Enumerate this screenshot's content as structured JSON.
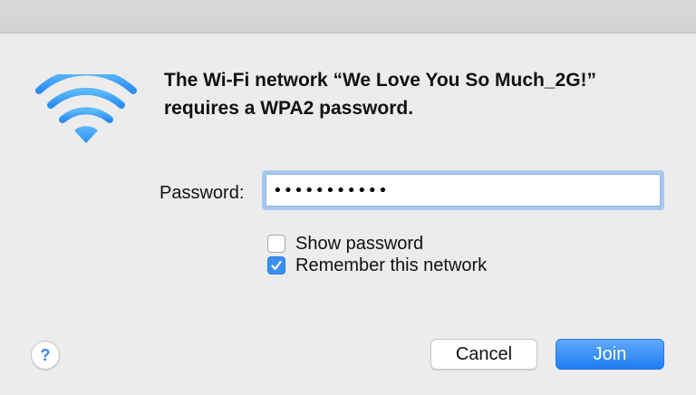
{
  "dialog": {
    "message_line1": "The Wi-Fi network “We Love You So Much_2G!”",
    "message_line2": "requires a WPA2 password.",
    "icon": "wifi-icon",
    "accent_color": "#3b8ff3"
  },
  "password": {
    "label": "Password:",
    "value": "•••••••••••"
  },
  "options": {
    "show_password": {
      "label": "Show password",
      "checked": false
    },
    "remember_network": {
      "label": "Remember this network",
      "checked": true
    }
  },
  "buttons": {
    "help_label": "?",
    "cancel_label": "Cancel",
    "join_label": "Join"
  }
}
